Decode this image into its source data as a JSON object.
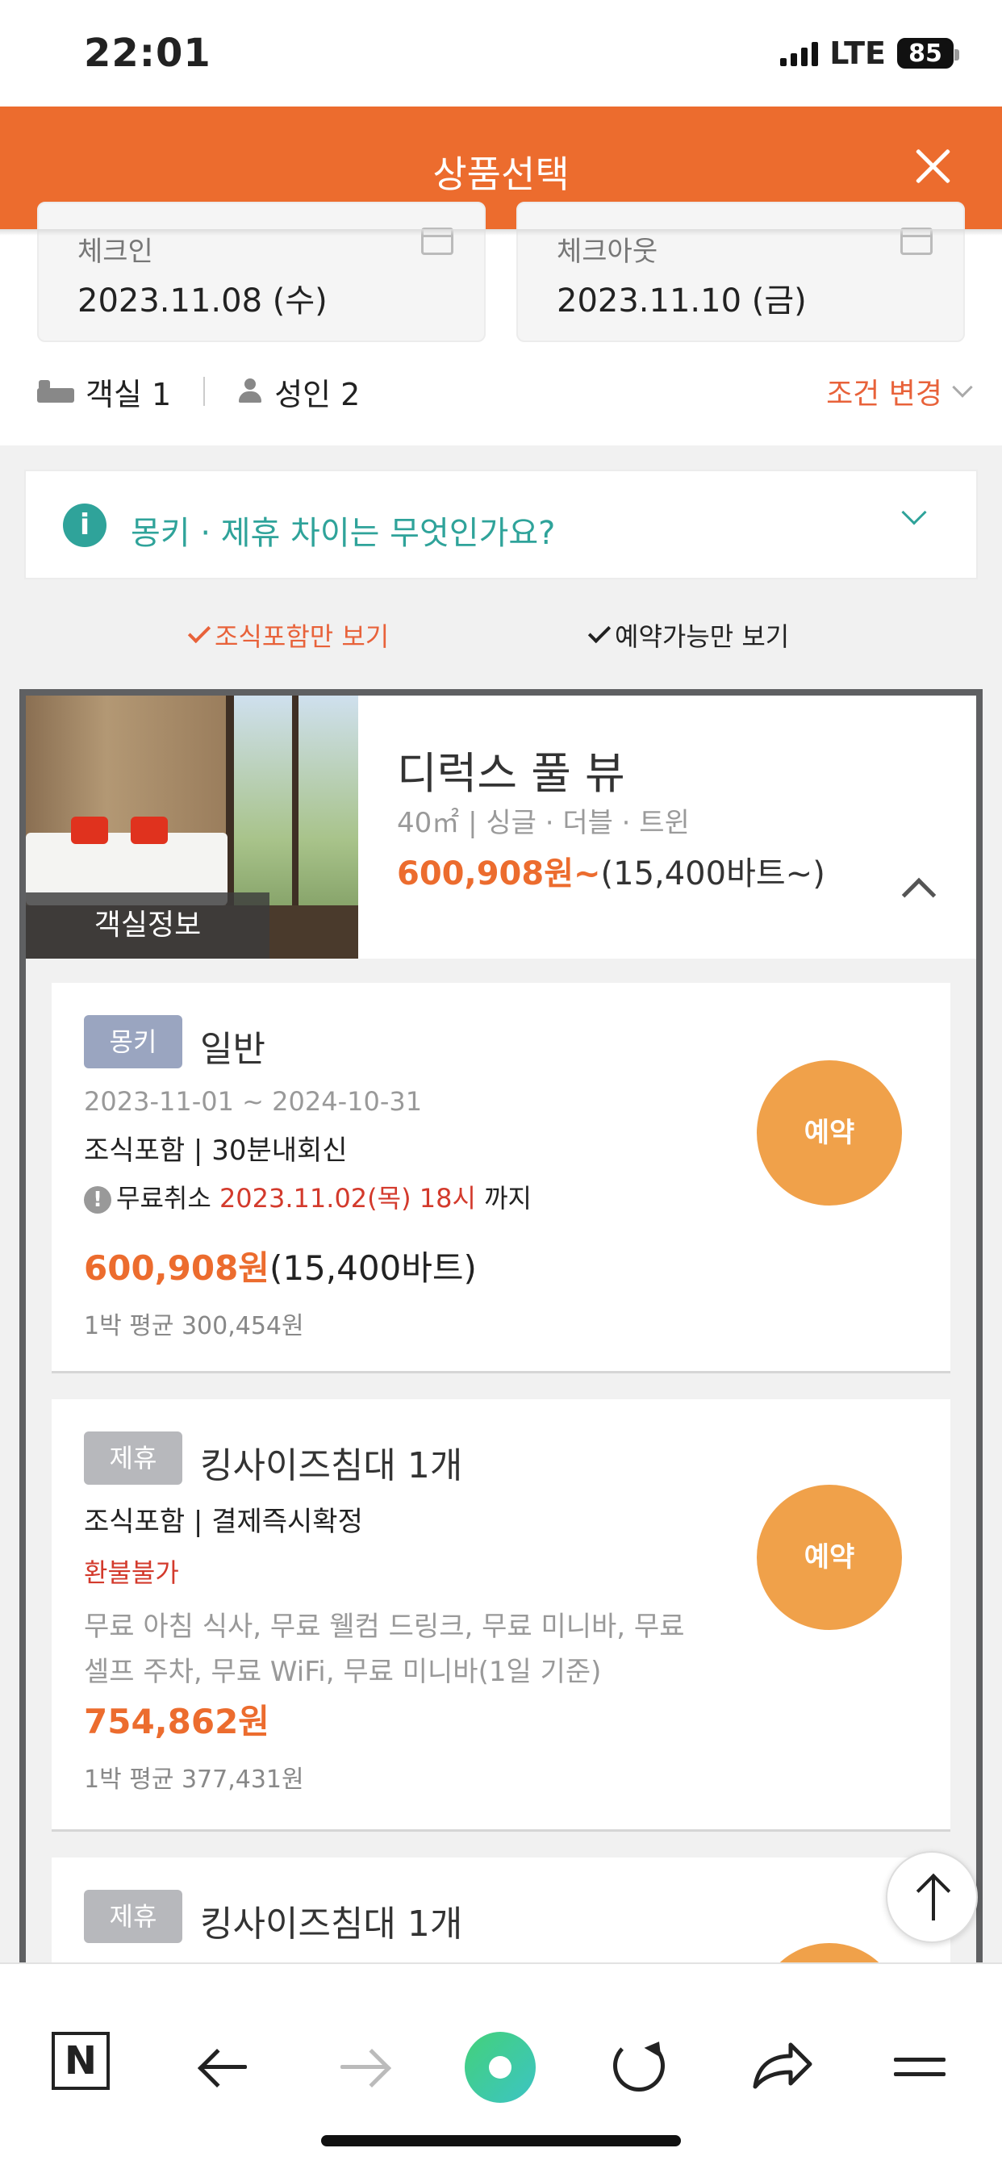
{
  "status_bar": {
    "time": "22:01",
    "network": "LTE",
    "battery": "85"
  },
  "header": {
    "title": "상품선택"
  },
  "dates": {
    "checkin_label": "체크인",
    "checkin_value": "2023.11.08 (수)",
    "checkout_label": "체크아웃",
    "checkout_value": "2023.11.10 (금)"
  },
  "guests": {
    "rooms": "객실 1",
    "adults": "성인 2",
    "change_label": "조건 변경"
  },
  "faq": {
    "icon": "i",
    "question": "몽키 · 제휴 차이는 무엇인가요?"
  },
  "filters": {
    "breakfast_only": "조식포함만 보기",
    "available_only": "예약가능만 보기"
  },
  "room": {
    "image_label": "객실정보",
    "name": "디럭스 풀 뷰",
    "spec": "40㎡ | 싱글 · 더블 · 트윈",
    "price": "600,908원~",
    "price_baht": "(15,400바트~)"
  },
  "plans": [
    {
      "badge": "몽키",
      "name": "일반",
      "period": "2023-11-01 ~ 2024-10-31",
      "conditions": "조식포함 | 30분내회신",
      "cancel_prefix": "무료취소",
      "cancel_date": "2023.11.02(목) 18시",
      "cancel_suffix": "까지",
      "price": "600,908원",
      "price_baht": "(15,400바트)",
      "avg": "1박 평균 300,454원",
      "book_label": "예약"
    },
    {
      "badge": "제휴",
      "name": "킹사이즈침대 1개",
      "conditions": "조식포함 | 결제즉시확정",
      "refund": "환불불가",
      "benefits_1": "무료 아침 식사, 무료 웰컴 드링크, 무료 미니바, 무료",
      "benefits_2": "셀프 주차, 무료 WiFi, 무료 미니바(1일 기준)",
      "price": "754,862원",
      "avg": "1박 평균 377,431원",
      "book_label": "예약"
    },
    {
      "badge": "제휴",
      "name": "킹사이즈침대 1개"
    }
  ],
  "bottom_bar": {
    "n_label": "N"
  },
  "colors": {
    "accent": "#ec6c2e",
    "teal": "#2fa39a",
    "book": "#f0a14a",
    "red": "#d33a2c"
  }
}
